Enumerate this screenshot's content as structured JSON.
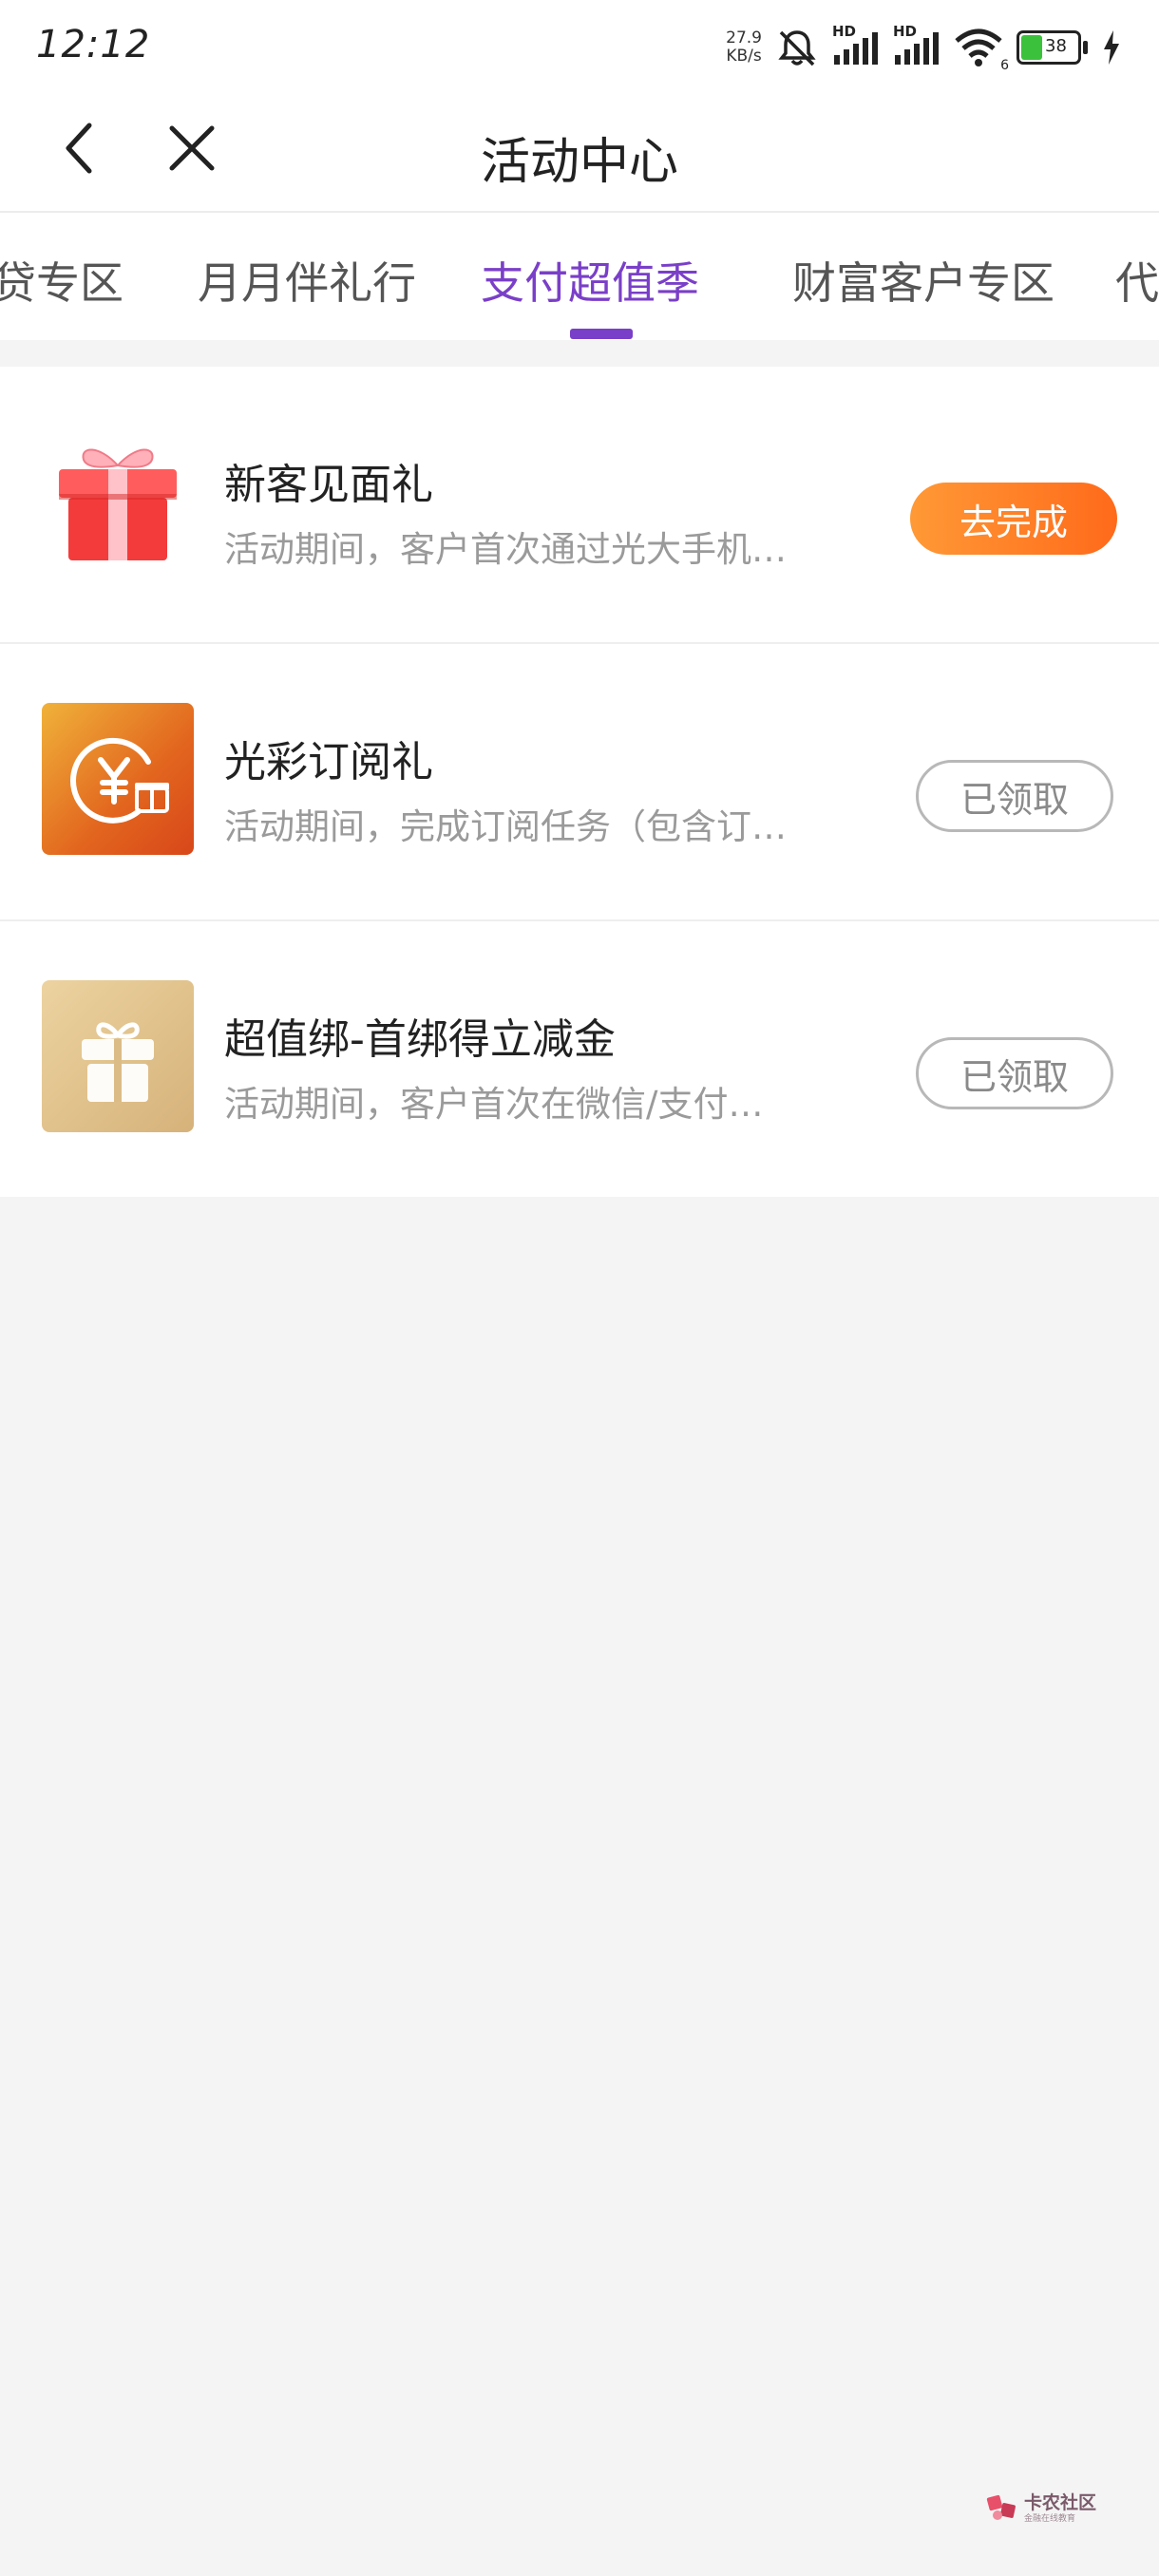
{
  "status_bar": {
    "time": "12:12",
    "net_speed_value": "27.9",
    "net_speed_unit": "KB/s",
    "signal1_label": "HD",
    "signal2_label": "HD",
    "wifi_badge": "6",
    "battery_level": "38"
  },
  "header": {
    "title": "活动中心",
    "back_icon": "chevron-left-icon",
    "close_icon": "close-icon"
  },
  "tabs": [
    {
      "label": "贷专区",
      "active": false
    },
    {
      "label": "月月伴礼行",
      "active": false
    },
    {
      "label": "支付超值季",
      "active": true
    },
    {
      "label": "财富客户专区",
      "active": false
    },
    {
      "label": "代",
      "active": false
    }
  ],
  "activities": [
    {
      "title": "新客见面礼",
      "description": "活动期间，客户首次通过光大手机…",
      "button_label": "去完成",
      "status": "pending",
      "icon": "gift-box-icon"
    },
    {
      "title": "光彩订阅礼",
      "description": "活动期间，完成订阅任务（包含订…",
      "button_label": "已领取",
      "status": "claimed",
      "icon": "yuan-gift-icon"
    },
    {
      "title": "超值绑-首绑得立减金",
      "description": "活动期间，客户首次在微信/支付…",
      "button_label": "已领取",
      "status": "claimed",
      "icon": "gift-icon"
    }
  ],
  "watermark": {
    "name": "卡农社区",
    "sub": "金融在线教育"
  },
  "colors": {
    "accent": "#7a3fc8",
    "primary_button": "#ff7a22",
    "background": "#f4f4f4"
  }
}
